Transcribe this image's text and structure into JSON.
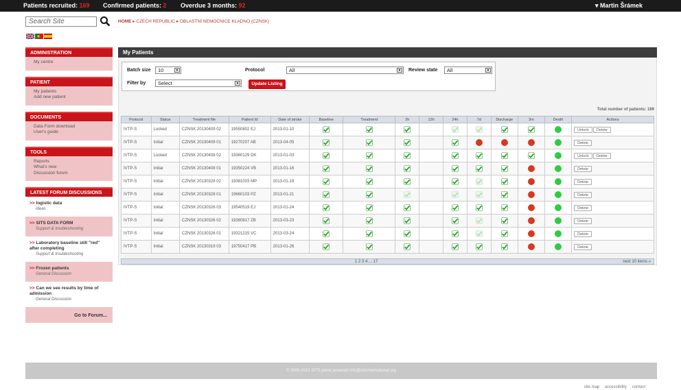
{
  "topbar": {
    "recruited_label": "Patients recruited:",
    "recruited_value": "169",
    "confirmed_label": "Confirmed patients:",
    "confirmed_value": "2",
    "overdue_label": "Overdue 3 months:",
    "overdue_value": "92",
    "user": "▾ Martin Šrámek"
  },
  "search": {
    "placeholder": "Search Site"
  },
  "breadcrumb": {
    "home": "HOME",
    "country": "CZECH REPUBLIC",
    "centre": "OBLASTNÍ NEMOCNICE KLADNO (CZNSK)"
  },
  "sidebar": {
    "administration": {
      "title": "ADMINISTRATION",
      "items": [
        "My centre"
      ]
    },
    "patient": {
      "title": "PATIENT",
      "items": [
        "My patients",
        "Add new patient"
      ]
    },
    "documents": {
      "title": "DOCUMENTS",
      "items": [
        "Data Form download",
        "User's guide"
      ]
    },
    "tools": {
      "title": "TOOLS",
      "items": [
        "Reports",
        "What's new",
        "Discussion forum"
      ]
    },
    "forum": {
      "title": "LATEST FORUM DISCUSSIONS",
      "items": [
        {
          "title": "logistic data",
          "category": "Ideas"
        },
        {
          "title": "SITS DATA FORM",
          "category": "Support & troubleshooting"
        },
        {
          "title": "Laboratory baseline still \"red\" after completing",
          "category": "Support & troubleshooting"
        },
        {
          "title": "Frozen patients",
          "category": "General Discussion"
        },
        {
          "title": "Can we see results by time of admission",
          "category": "General Discussion"
        }
      ],
      "goto": "Go to Forum..."
    }
  },
  "main": {
    "title": "My Patients",
    "batch_label": "Batch size",
    "batch_value": "10",
    "protocol_label": "Protocol",
    "protocol_value": "All",
    "review_label": "Review state",
    "review_value": "All",
    "filter_label": "Filter by",
    "filter_value": "Select",
    "update_label": "Update Listing",
    "total": "Total number of patients: 169",
    "columns": [
      "Protocol",
      "Status",
      "Treatment file",
      "Patient Id",
      "Date of stroke",
      "Baseline",
      "Treatment",
      "2h",
      "12h",
      "24h",
      "7d",
      "Discharge",
      "3m",
      "Death",
      "Actions"
    ],
    "rows": [
      {
        "protocol": "IVTP-S",
        "status": "Locked",
        "file": "CZNSK 20130409 02",
        "pid": "19550802 EJ",
        "date": "2013-01-10",
        "cells": [
          "c",
          "c",
          "c",
          "",
          "l",
          "l",
          "c",
          "c",
          "g"
        ],
        "actions": [
          "Unlock",
          "Delete"
        ]
      },
      {
        "protocol": "IVTP-S",
        "status": "Initial",
        "file": "CZNSK 20130409 01",
        "pid": "19270207 AB",
        "date": "2013-04-05",
        "cells": [
          "c",
          "c",
          "c",
          "",
          "c",
          "r",
          "r",
          "r",
          "g"
        ],
        "actions": [
          "Delete"
        ]
      },
      {
        "protocol": "IVTP-S",
        "status": "Locked",
        "file": "CZNSK 20130408 02",
        "pid": "19360129 DK",
        "date": "2013-01-03",
        "cells": [
          "c",
          "c",
          "c",
          "",
          "c",
          "c",
          "c",
          "c",
          "g"
        ],
        "actions": [
          "Unlock",
          "Delete"
        ]
      },
      {
        "protocol": "IVTP-S",
        "status": "Initial",
        "file": "CZNSK 20130408 01",
        "pid": "19350224 VB",
        "date": "2013-01-16",
        "cells": [
          "c",
          "c",
          "c",
          "",
          "c",
          "c",
          "c",
          "r",
          "g"
        ],
        "actions": [
          "Delete"
        ]
      },
      {
        "protocol": "IVTP-S",
        "status": "Initial",
        "file": "CZNSK 20130328 02",
        "pid": "19381003 MP",
        "date": "2013-01-19",
        "cells": [
          "c",
          "c",
          "c",
          "",
          "c",
          "l",
          "c",
          "r",
          "g"
        ],
        "actions": [
          "Delete"
        ]
      },
      {
        "protocol": "IVTP-S",
        "status": "Initial",
        "file": "CZNSK 20130328 01",
        "pid": "19660103 PZ",
        "date": "2013-01-21",
        "cells": [
          "c",
          "c",
          "l",
          "",
          "l",
          "l",
          "c",
          "r",
          "g"
        ],
        "actions": [
          "Delete"
        ]
      },
      {
        "protocol": "IVTP-S",
        "status": "Initial",
        "file": "CZNSK 20130326 03",
        "pid": "19540519 EJ",
        "date": "2013-01-24",
        "cells": [
          "c",
          "c",
          "c",
          "",
          "c",
          "c",
          "c",
          "r",
          "g"
        ],
        "actions": [
          "Delete"
        ]
      },
      {
        "protocol": "IVTP-S",
        "status": "Initial",
        "file": "CZNSK 20130326 02",
        "pid": "19360817 ZB",
        "date": "2013-03-23",
        "cells": [
          "c",
          "c",
          "c",
          "",
          "c",
          "l",
          "c",
          "r",
          "g"
        ],
        "actions": [
          "Delete"
        ]
      },
      {
        "protocol": "IVTP-S",
        "status": "Initial",
        "file": "CZNSK 20130326 01",
        "pid": "19321215 VC",
        "date": "2013-03-24",
        "cells": [
          "c",
          "c",
          "c",
          "",
          "c",
          "l",
          "c",
          "r",
          "g"
        ],
        "actions": [
          "Delete"
        ]
      },
      {
        "protocol": "IVTP-S",
        "status": "Initial",
        "file": "CZNSK 20130319 03",
        "pid": "19750417 PB",
        "date": "2013-01-26",
        "cells": [
          "c",
          "c",
          "c",
          "",
          "c",
          "c",
          "c",
          "r",
          "g"
        ],
        "actions": [
          "Delete"
        ]
      }
    ],
    "pager": "1 2 3 4 ... 17",
    "next": "next 10 items »"
  },
  "footer": {
    "text": "© 2000-2013 SITS  plone powered  info@sitsinternational.org"
  },
  "footlinks": [
    "site map",
    "accessibility",
    "contact"
  ],
  "colors": {
    "accent": "#c8141b",
    "pink": "#f0c4c6",
    "check": "#2e9e2e",
    "check_light": "#b8dcb8",
    "dot_red": "#d9381e",
    "dot_green": "#2ecc40"
  }
}
